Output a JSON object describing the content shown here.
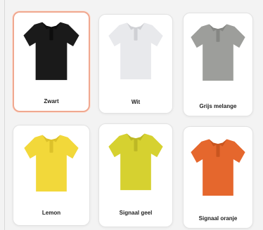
{
  "colors": {
    "selected_border": "#f0a890",
    "background": "#f3f3f3",
    "card": "#ffffff"
  },
  "swatches": [
    {
      "label": "Zwart",
      "shirt_color": "#1a1a1a",
      "shade": "#0d0d0d",
      "selected": true
    },
    {
      "label": "Wit",
      "shirt_color": "#e8e9ec",
      "shade": "#cfd0d4",
      "selected": false
    },
    {
      "label": "Grijs melange",
      "shirt_color": "#9d9e9b",
      "shade": "#868784",
      "selected": false
    },
    {
      "label": "Lemon",
      "shirt_color": "#f2d83a",
      "shade": "#dcc12a",
      "selected": false
    },
    {
      "label": "Signaal geel",
      "shirt_color": "#d6d130",
      "shade": "#bdb825",
      "selected": false
    },
    {
      "label": "Signaal oranje",
      "shirt_color": "#e5672d",
      "shade": "#c9551f",
      "selected": false
    }
  ]
}
